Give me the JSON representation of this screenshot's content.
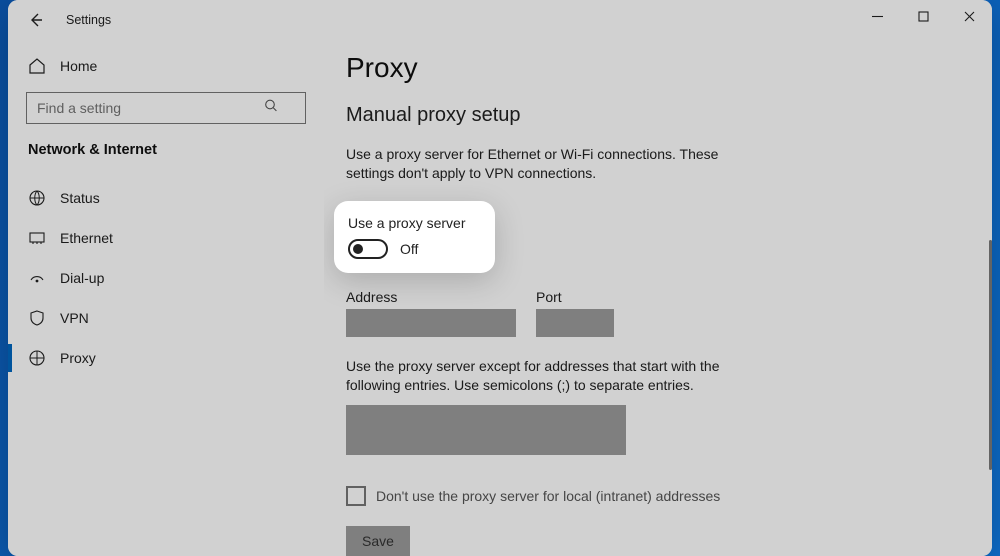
{
  "titlebar": {
    "label": "Settings"
  },
  "sidebar": {
    "home": "Home",
    "search_placeholder": "Find a setting",
    "group": "Network & Internet",
    "items": [
      {
        "label": "Status",
        "icon": "status"
      },
      {
        "label": "Ethernet",
        "icon": "ethernet"
      },
      {
        "label": "Dial-up",
        "icon": "dialup"
      },
      {
        "label": "VPN",
        "icon": "vpn"
      },
      {
        "label": "Proxy",
        "icon": "proxy"
      }
    ],
    "active_index": 4
  },
  "main": {
    "title": "Proxy",
    "section": "Manual proxy setup",
    "description": "Use a proxy server for Ethernet or Wi-Fi connections. These settings don't apply to VPN connections.",
    "toggle_label": "Use a proxy server",
    "toggle_state": "Off",
    "address_label": "Address",
    "address_value": "",
    "port_label": "Port",
    "port_value": "",
    "exceptions_text": "Use the proxy server except for addresses that start with the following entries. Use semicolons (;) to separate entries.",
    "exceptions_value": "",
    "bypass_local_label": "Don't use the proxy server for local (intranet) addresses",
    "save_label": "Save"
  }
}
